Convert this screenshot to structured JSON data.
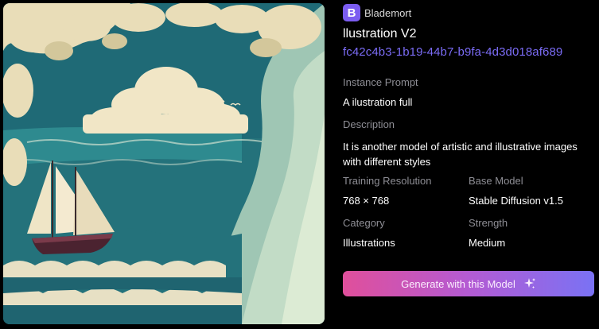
{
  "author": {
    "initial": "B",
    "name": "Blademort",
    "avatar_color": "#7b5cf0"
  },
  "model": {
    "title": "llustration V2",
    "id": "fc42c4b3-1b19-44b7-b9fa-4d3d018af689"
  },
  "details": {
    "instance_prompt_label": "Instance Prompt",
    "instance_prompt_value": "A ilustration full",
    "description_label": "Description",
    "description_value": "It is another model of artistic and illustrative images with different styles",
    "training_resolution_label": "Training Resolution",
    "training_resolution_value": "768 × 768",
    "base_model_label": "Base Model",
    "base_model_value": "Stable Diffusion v1.5",
    "category_label": "Category",
    "category_value": "Illustrations",
    "strength_label": "Strength",
    "strength_value": "Medium"
  },
  "actions": {
    "generate_label": "Generate with this Model",
    "generate_icon": "sparkle-icon"
  },
  "colors": {
    "background": "#000000",
    "accent": "#7b6cf6",
    "button_gradient_start": "#e04f9b",
    "button_gradient_end": "#7a72f4",
    "label_gray": "#8e8e95"
  }
}
